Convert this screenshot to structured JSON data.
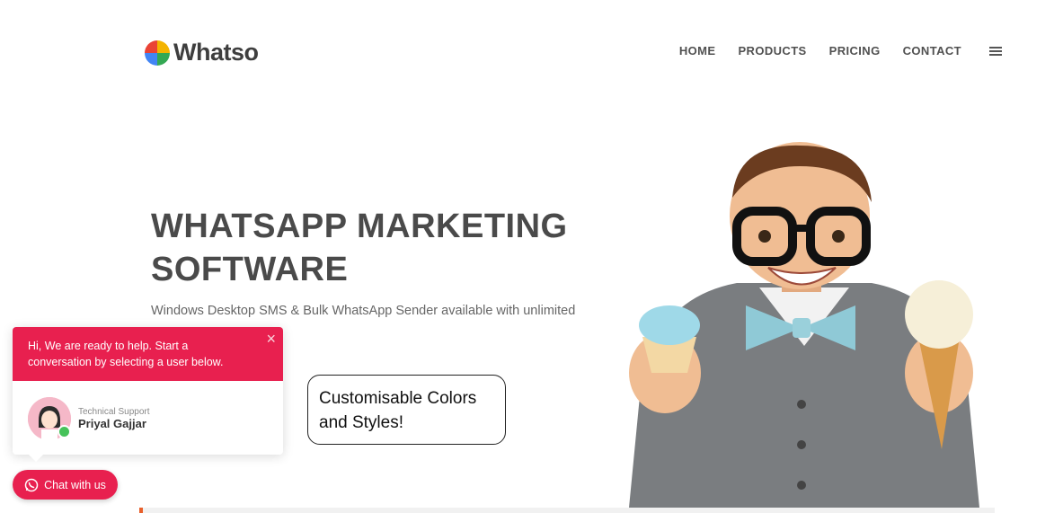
{
  "header": {
    "brand": "Whatso",
    "nav": [
      {
        "label": "HOME"
      },
      {
        "label": "PRODUCTS"
      },
      {
        "label": "PRICING"
      },
      {
        "label": "CONTACT"
      }
    ]
  },
  "hero": {
    "title": "WHATSAPP MARKETING SOFTWARE",
    "subtitle": "Windows Desktop SMS & Bulk WhatsApp Sender available with unlimited"
  },
  "callout": {
    "text": "Customisable Colors and Styles!"
  },
  "chat_widget": {
    "greeting": "Hi, We are ready to help. Start a conversation by selecting a user below.",
    "close_symbol": "×",
    "agent_role": "Technical Support",
    "agent_name": "Priyal Gajjar",
    "button_label": "Chat with us"
  },
  "colors": {
    "brand_accent": "#e8204f",
    "heading": "#4a4a4a",
    "bar_accent": "#e8602c"
  },
  "icons": {
    "menu": "hamburger-icon",
    "chat": "whatsapp-icon",
    "close": "close-icon"
  }
}
